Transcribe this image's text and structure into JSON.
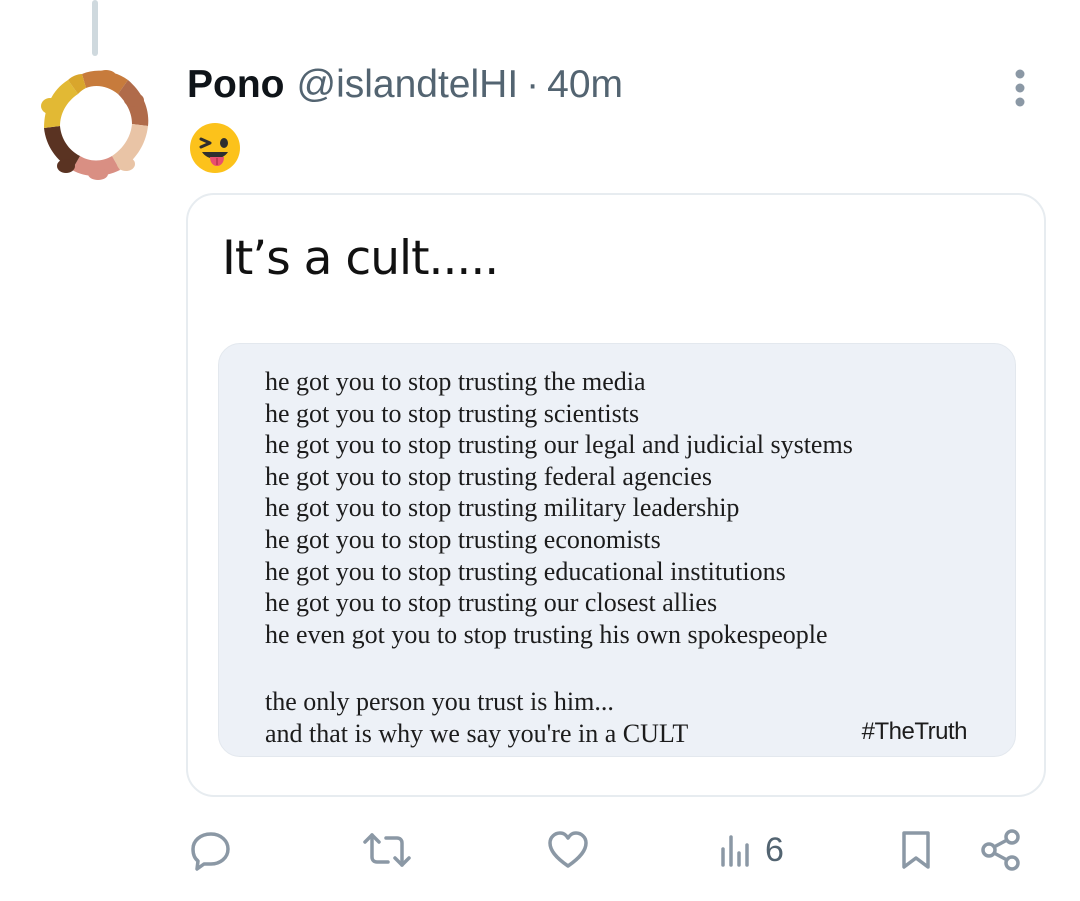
{
  "tweet": {
    "display_name": "Pono",
    "handle": "@islandtelHI",
    "separator": "·",
    "time": "40m",
    "emoji": "😜"
  },
  "card": {
    "title": "It’s a cult.....",
    "lines": [
      "he got you to stop trusting the media",
      "he got you to stop trusting scientists",
      "he got you to stop trusting our legal and judicial systems",
      "he got you to stop trusting federal agencies",
      "he got you to stop trusting military leadership",
      "he got you to stop trusting economists",
      "he got you to stop trusting educational institutions",
      "he got you to stop trusting our closest allies",
      "he even got you to stop trusting his own spokespeople"
    ],
    "closing": [
      "the only person you trust is him...",
      "and that is why we say you're in a CULT"
    ],
    "hashtag": "#TheTruth"
  },
  "actions": {
    "reply_icon": "reply-icon",
    "retweet_icon": "retweet-icon",
    "like_icon": "heart-icon",
    "views_icon": "views-icon",
    "views_count": "6",
    "bookmark_icon": "bookmark-icon",
    "share_icon": "share-icon"
  },
  "colors": {
    "text": "#0f1419",
    "secondary": "#536471",
    "border": "#e7ecf0",
    "quote_bg": "#edf1f7"
  }
}
